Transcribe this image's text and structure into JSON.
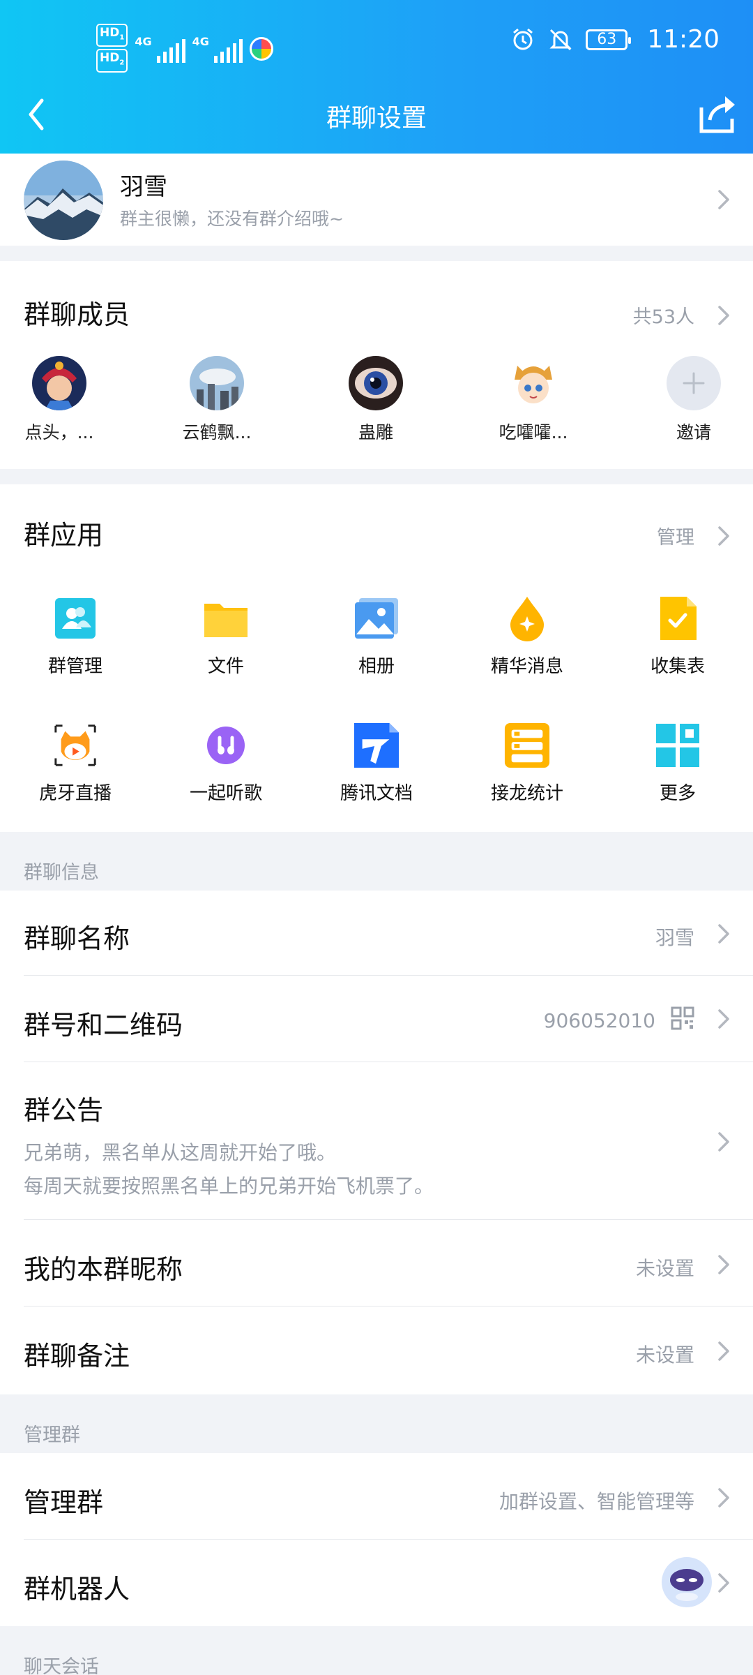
{
  "status_bar": {
    "hd1": "HD",
    "hd1_sub": "1",
    "hd2": "HD",
    "hd2_sub": "2",
    "net1": "4G",
    "net2": "4G",
    "battery": "63",
    "time": "11:20"
  },
  "header": {
    "title": "群聊设置",
    "back_icon": "chevron-left-icon",
    "share_icon": "share-icon",
    "bg_colors": [
      "#10c6f4",
      "#1e8ff6"
    ]
  },
  "profile": {
    "name": "羽雪",
    "description": "群主很懒，还没有群介绍哦~"
  },
  "members": {
    "title": "群聊成员",
    "count": "共53人",
    "list": [
      {
        "name": "点头，..."
      },
      {
        "name": "云鹤飘..."
      },
      {
        "name": "蛊雕"
      },
      {
        "name": "吃嚯嚯..."
      },
      {
        "name": "邀请"
      }
    ]
  },
  "group_apps": {
    "title": "群应用",
    "manage_label": "管理",
    "items": [
      {
        "label": "群管理",
        "icon": "group-manage-icon"
      },
      {
        "label": "文件",
        "icon": "folder-icon"
      },
      {
        "label": "相册",
        "icon": "album-icon"
      },
      {
        "label": "精华消息",
        "icon": "essence-icon"
      },
      {
        "label": "收集表",
        "icon": "form-icon"
      },
      {
        "label": "虎牙直播",
        "icon": "huya-live-icon"
      },
      {
        "label": "一起听歌",
        "icon": "music-icon"
      },
      {
        "label": "腾讯文档",
        "icon": "tencent-docs-icon"
      },
      {
        "label": "接龙统计",
        "icon": "relay-stats-icon"
      },
      {
        "label": "更多",
        "icon": "more-grid-icon"
      }
    ]
  },
  "info_section": {
    "label": "群聊信息",
    "group_name_label": "群聊名称",
    "group_name_value": "羽雪",
    "group_id_label": "群号和二维码",
    "group_id_value": "906052010",
    "notice_label": "群公告",
    "notice_line1": "兄弟萌，黑名单从这周就开始了哦。",
    "notice_line2": "每周天就要按照黑名单上的兄弟开始飞机票了。",
    "nickname_label": "我的本群昵称",
    "nickname_value": "未设置",
    "remark_label": "群聊备注",
    "remark_value": "未设置"
  },
  "manage_section": {
    "label": "管理群",
    "manage_label": "管理群",
    "manage_value": "加群设置、智能管理等",
    "robot_label": "群机器人"
  },
  "chat_section": {
    "label": "聊天会话"
  }
}
